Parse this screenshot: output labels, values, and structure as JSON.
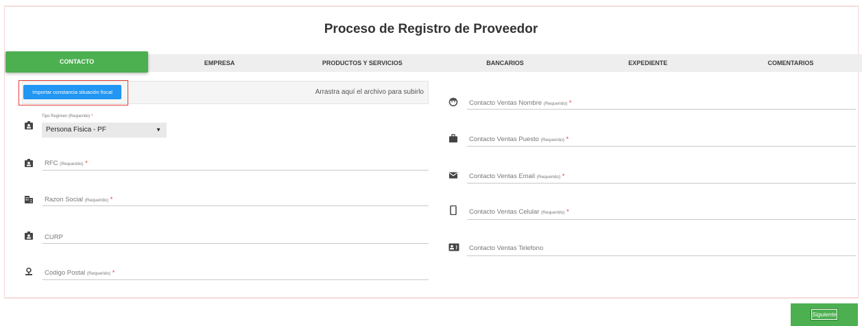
{
  "page": {
    "title": "Proceso de Registro de Proveedor"
  },
  "tabs": [
    {
      "label": "CONTACTO",
      "active": true
    },
    {
      "label": "EMPRESA",
      "active": false
    },
    {
      "label": "PRODUCTOS Y SERVICIOS",
      "active": false
    },
    {
      "label": "BANCARIOS",
      "active": false
    },
    {
      "label": "EXPEDIENTE",
      "active": false
    },
    {
      "label": "COMENTARIOS",
      "active": false
    }
  ],
  "upload": {
    "button_label": "Importar constancia situación fiscal",
    "drop_hint": "Arrastra aquí el archivo para subirlo"
  },
  "left_form": {
    "regimen": {
      "label": "Tipo Regimen",
      "req_hint": "(Requerido)",
      "required_mark": "*",
      "selected": "Persona Fisica - PF",
      "icon": "badge-icon"
    },
    "rfc": {
      "label": "RFC",
      "req_hint": "(Requerido)",
      "required_mark": "*",
      "icon": "badge-icon"
    },
    "razon_social": {
      "label": "Razon Social",
      "req_hint": "(Requerido)",
      "required_mark": "*",
      "icon": "building-icon"
    },
    "curp": {
      "label": "CURP",
      "icon": "badge-icon"
    },
    "codigo_postal": {
      "label": "Codigo Postal",
      "req_hint": "(Requerido)",
      "required_mark": "*",
      "icon": "pin-icon"
    }
  },
  "right_form": {
    "nombre": {
      "label": "Contacto Ventas Nombre",
      "req_hint": "(Requerido)",
      "required_mark": "*",
      "icon": "face-icon"
    },
    "puesto": {
      "label": "Contacto Ventas Puesto",
      "req_hint": "(Requerido)",
      "required_mark": "*",
      "icon": "briefcase-icon"
    },
    "email": {
      "label": "Contacto Ventas Email",
      "req_hint": "(Requerido)",
      "required_mark": "*",
      "icon": "mail-icon"
    },
    "celular": {
      "label": "Contacto Ventas Celular",
      "req_hint": "(Requerido)",
      "required_mark": "*",
      "icon": "phone-icon"
    },
    "telefono": {
      "label": "Contacto Ventas Telefono",
      "icon": "contact-phone-icon"
    }
  },
  "actions": {
    "next_label": "Siguiente"
  },
  "colors": {
    "accent_green": "#4caf50",
    "button_blue": "#2196f3",
    "required_red": "#e53935",
    "highlight_red": "#e53935"
  }
}
